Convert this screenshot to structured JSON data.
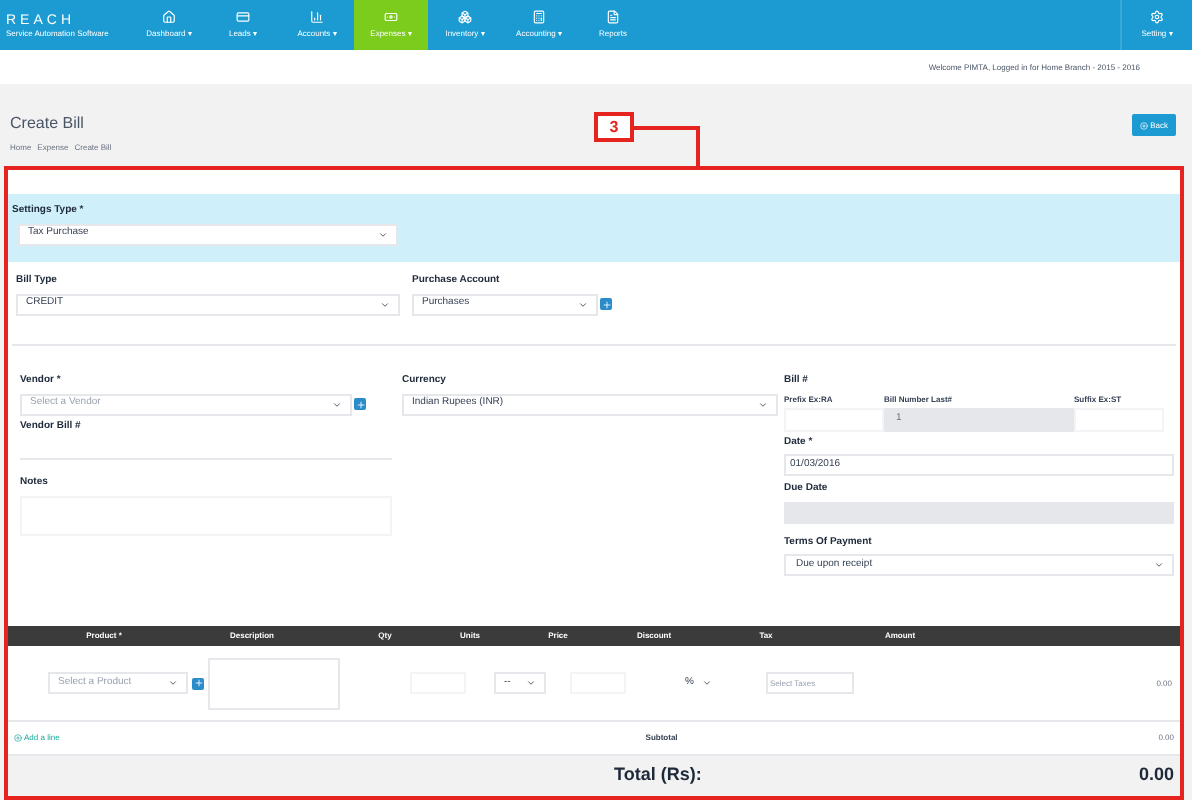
{
  "brand": {
    "name": "REACH",
    "tagline": "Service Automation Software"
  },
  "nav": [
    {
      "label": "Dashboard ▾",
      "kind": "home",
      "selected": false
    },
    {
      "label": "Leads ▾",
      "kind": "card",
      "selected": false
    },
    {
      "label": "Accounts ▾",
      "kind": "chart",
      "selected": false
    },
    {
      "label": "Expenses ▾",
      "kind": "money",
      "selected": true
    },
    {
      "label": "Inventory ▾",
      "kind": "boxes",
      "selected": false
    },
    {
      "label": "Accounting ▾",
      "kind": "calc",
      "selected": false
    },
    {
      "label": "Reports",
      "kind": "doc",
      "selected": false
    }
  ],
  "settings": {
    "label": "Setting ▾"
  },
  "welcome": "Welcome PIMTA, Logged in for Home Branch - 2015 - 2016",
  "page": {
    "title": "Create Bill",
    "breadcrumb": [
      "Home",
      "Expense",
      "Create Bill"
    ],
    "back_button": "Back",
    "callout": "3"
  },
  "settings_type": {
    "label": "Settings Type *",
    "value": "Tax Purchase"
  },
  "bill_type": {
    "label": "Bill Type",
    "value": "CREDIT"
  },
  "purchase_account": {
    "label": "Purchase Account",
    "value": "Purchases"
  },
  "vendor": {
    "label": "Vendor *",
    "placeholder": "Select a Vendor"
  },
  "vendor_bill": {
    "label": "Vendor Bill #"
  },
  "notes": {
    "label": "Notes"
  },
  "currency": {
    "label": "Currency",
    "value": "Indian Rupees (INR)"
  },
  "bill_number": {
    "label": "Bill #",
    "prefix_label": "Prefix Ex:RA",
    "number_label": "Bill Number Last#",
    "number_value": "1",
    "suffix_label": "Suffix Ex:ST"
  },
  "date": {
    "label": "Date *",
    "value": "01/03/2016"
  },
  "due_date": {
    "label": "Due Date"
  },
  "terms": {
    "label": "Terms Of Payment",
    "value": "Due upon receipt"
  },
  "table": {
    "columns": [
      "Product *",
      "Description",
      "Qty",
      "Units",
      "Price",
      "Discount",
      "Tax",
      "Amount"
    ],
    "row": {
      "product_placeholder": "Select a Product",
      "units": "--",
      "discount": "%",
      "tax_placeholder": "Select Taxes",
      "amount": "0.00"
    }
  },
  "add_line": "Add a line",
  "subtotal": {
    "label": "Subtotal",
    "value": "0.00"
  },
  "total": {
    "label": "Total (Rs):",
    "value": "0.00"
  }
}
